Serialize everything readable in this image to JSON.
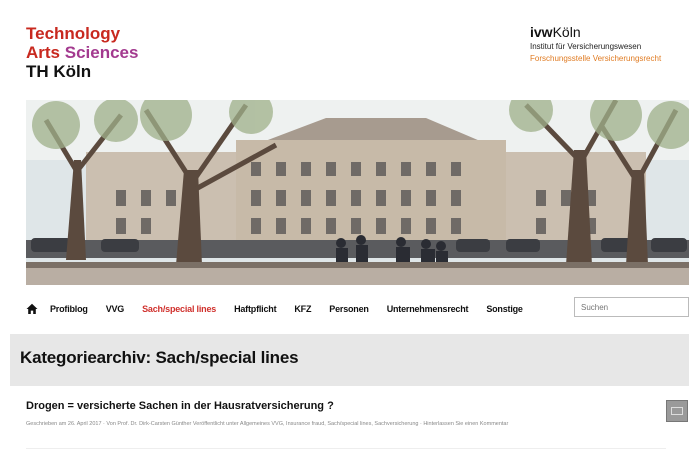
{
  "logo": {
    "line1": "Technology",
    "line2_a": "Arts",
    "line2_b": "Sciences",
    "line3": "TH Köln"
  },
  "institute": {
    "brand_bold": "ivw",
    "brand_light": "Köln",
    "subtitle1": "Institut für Versicherungswesen",
    "subtitle2": "Forschungsstelle Versicherungsrecht"
  },
  "nav": {
    "items": [
      {
        "label": "Profiblog"
      },
      {
        "label": "VVG"
      },
      {
        "label": "Sach/special lines",
        "active": true
      },
      {
        "label": "Haftpflicht"
      },
      {
        "label": "KFZ"
      },
      {
        "label": "Personen"
      },
      {
        "label": "Unternehmensrecht"
      },
      {
        "label": "Sonstige"
      }
    ],
    "search_placeholder": "Suchen"
  },
  "archive": {
    "heading": "Kategoriearchiv: Sach/special lines"
  },
  "post": {
    "title": "Drogen = versicherte Sachen in der Hausratversicherung ?",
    "meta": "Geschrieben am 26. April 2017 · Von Prof. Dr. Dirk-Carsten Günther Veröffentlicht unter Allgemeines VVG, Insurance fraud, Sach/special lines, Sachversicherung · Hinterlassen Sie einen Kommentar"
  },
  "colors": {
    "brand_red": "#c8291f",
    "brand_purple": "#a33a8f",
    "accent_orange": "#e07b22",
    "nav_active": "#d0312d",
    "band_bg": "#e7e7e7"
  }
}
